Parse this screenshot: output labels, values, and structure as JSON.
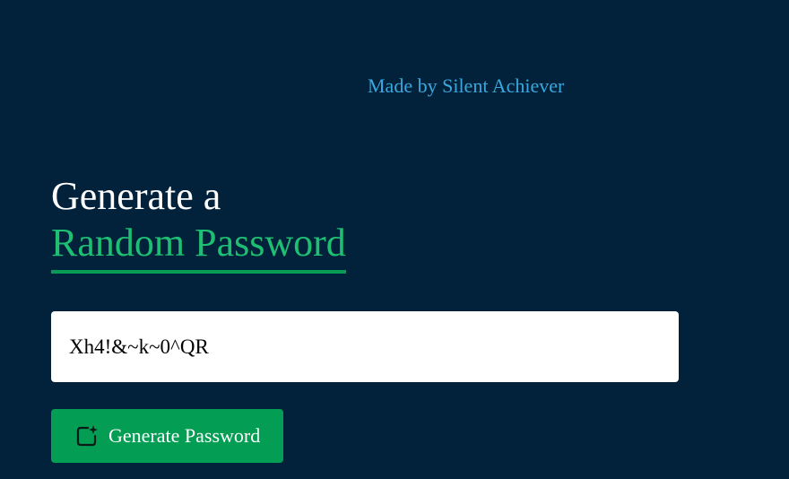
{
  "credit": {
    "text": "Made by Silent Achiever"
  },
  "heading": {
    "line1": "Generate a",
    "line2": "Random Password"
  },
  "password": {
    "value": "Xh4!&~k~0^QR"
  },
  "generate_button": {
    "label": "Generate Password",
    "icon": "magic-square-icon"
  },
  "colors": {
    "background": "#01223a",
    "accent": "#1ebf72",
    "button": "#039d53",
    "credit": "#3aa8de"
  }
}
